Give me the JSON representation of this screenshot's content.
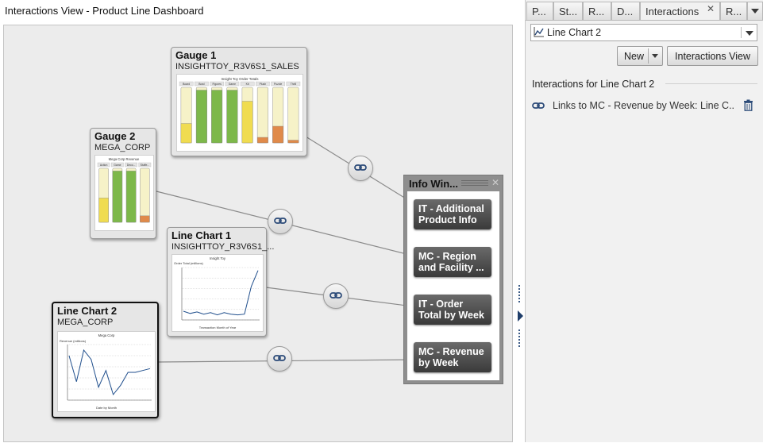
{
  "view": {
    "title": "Interactions View - Product Line Dashboard"
  },
  "colors": {
    "accent": "#1f4e8c",
    "bar_green": "#7db84a",
    "bar_yellow": "#f0dc50",
    "bar_orange": "#e08a4a"
  },
  "nodes": {
    "gauge1": {
      "title": "Gauge 1",
      "subtitle": "INSIGHTTOY_R3V6S1_SALES",
      "thumb_title": "Insight Toy Order Totals",
      "columns": [
        "Board",
        "Bowl",
        "Figures",
        "Game",
        "Kit",
        "Plush",
        "Puzzle",
        "Thrill"
      ],
      "levels": [
        0.35,
        0.95,
        0.95,
        0.95,
        0.75,
        0.1,
        0.3,
        0.05
      ],
      "level_colors": [
        "#f0dc50",
        "#7db84a",
        "#7db84a",
        "#7db84a",
        "#f0dc50",
        "#e08a4a",
        "#e08a4a",
        "#e08a4a"
      ]
    },
    "gauge2": {
      "title": "Gauge 2",
      "subtitle": "MEGA_CORP",
      "thumb_title": "Mega Corp Revenue",
      "columns": [
        "Action",
        "Game",
        "Deco...",
        "Stuffe..."
      ],
      "levels": [
        0.45,
        0.95,
        0.95,
        0.12
      ],
      "level_colors": [
        "#f0dc50",
        "#7db84a",
        "#7db84a",
        "#e08a4a"
      ]
    },
    "line1": {
      "title": "Line Chart 1",
      "subtitle": "INSIGHTTOY_R3V6S1_...",
      "thumb_title": "Insight Toy",
      "thumb_ylabel": "Order Total (millions)",
      "thumb_xlabel": "Transaction Month of Year",
      "values": [
        1.8,
        1.65,
        1.75,
        1.6,
        1.7,
        1.55,
        1.7,
        1.6,
        1.55,
        1.6,
        3.5,
        4.6
      ]
    },
    "line2": {
      "title": "Line Chart 2",
      "subtitle": "MEGA_CORP",
      "thumb_title": "Mega Corp",
      "thumb_ylabel": "Revenue (millions)",
      "thumb_xlabel": "Date by Month",
      "values": [
        2.4,
        1.7,
        2.55,
        2.3,
        1.55,
        2.0,
        1.35,
        1.6,
        1.95,
        1.95,
        2.0,
        2.05
      ]
    }
  },
  "info_window": {
    "title": "Info Win...",
    "targets": [
      {
        "label": "IT - Additional Product Info"
      },
      {
        "label": "MC - Region and Facility ..."
      },
      {
        "label": "IT - Order Total by Week"
      },
      {
        "label": "MC - Revenue by Week"
      }
    ]
  },
  "panel": {
    "tabs": [
      "P...",
      "St...",
      "R...",
      "D...",
      "Interactions",
      "R..."
    ],
    "selected_chart": "Line Chart 2",
    "new_label": "New",
    "interactions_view_label": "Interactions View",
    "section_title": "Interactions for Line Chart 2",
    "interaction_item": "Links to MC - Revenue by Week: Line C..."
  }
}
